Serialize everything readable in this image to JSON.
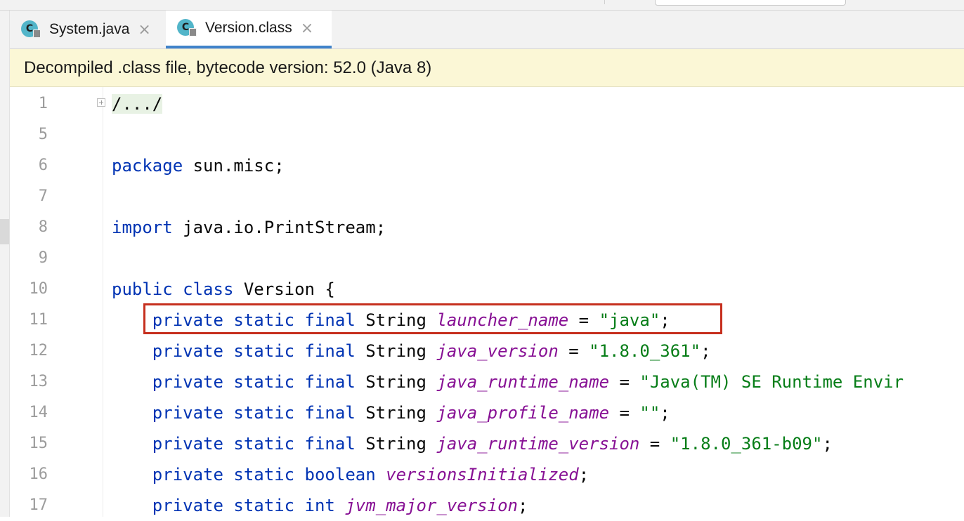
{
  "tabs": [
    {
      "label": "System.java",
      "icon": "C",
      "close": "×"
    },
    {
      "label": "Version.class",
      "icon": "C",
      "close": "×"
    }
  ],
  "banner": {
    "text": "Decompiled .class file, bytecode version: 52.0 (Java 8)"
  },
  "colors": {
    "keyword": "#0033b3",
    "field": "#871094",
    "string": "#067d17",
    "highlight_border": "#c62f1e",
    "banner_bg": "#fbf7d6",
    "active_tab_underline": "#4083c9"
  },
  "code": {
    "l1": {
      "num": "1",
      "folded": "/.../"
    },
    "l5": {
      "num": "5"
    },
    "l6": {
      "num": "6",
      "kw": "package",
      "rest": " sun.misc;"
    },
    "l7": {
      "num": "7"
    },
    "l8": {
      "num": "8",
      "kw": "import",
      "rest": " java.io.PrintStream;"
    },
    "l9": {
      "num": "9"
    },
    "l10": {
      "num": "10",
      "kw": "public class",
      "rest": " Version {"
    },
    "l11": {
      "num": "11",
      "kw": "private static final",
      "type": " String ",
      "field": "launcher_name",
      "eq": " = ",
      "str": "\"java\"",
      "end": ";"
    },
    "l12": {
      "num": "12",
      "kw": "private static final",
      "type": " String ",
      "field": "java_version",
      "eq": " = ",
      "str": "\"1.8.0_361\"",
      "end": ";"
    },
    "l13": {
      "num": "13",
      "kw": "private static final",
      "type": " String ",
      "field": "java_runtime_name",
      "eq": " = ",
      "str": "\"Java(TM) SE Runtime Envir"
    },
    "l14": {
      "num": "14",
      "kw": "private static final",
      "type": " String ",
      "field": "java_profile_name",
      "eq": " = ",
      "str": "\"\"",
      "end": ";"
    },
    "l15": {
      "num": "15",
      "kw": "private static final",
      "type": " String ",
      "field": "java_runtime_version",
      "eq": " = ",
      "str": "\"1.8.0_361-b09\"",
      "end": ";"
    },
    "l16": {
      "num": "16",
      "kw": "private static boolean",
      "sp": " ",
      "field": "versionsInitialized",
      "end": ";"
    },
    "l17": {
      "num": "17",
      "kw": "private static int",
      "sp": " ",
      "field": "jvm_major_version",
      "end": ";"
    }
  }
}
